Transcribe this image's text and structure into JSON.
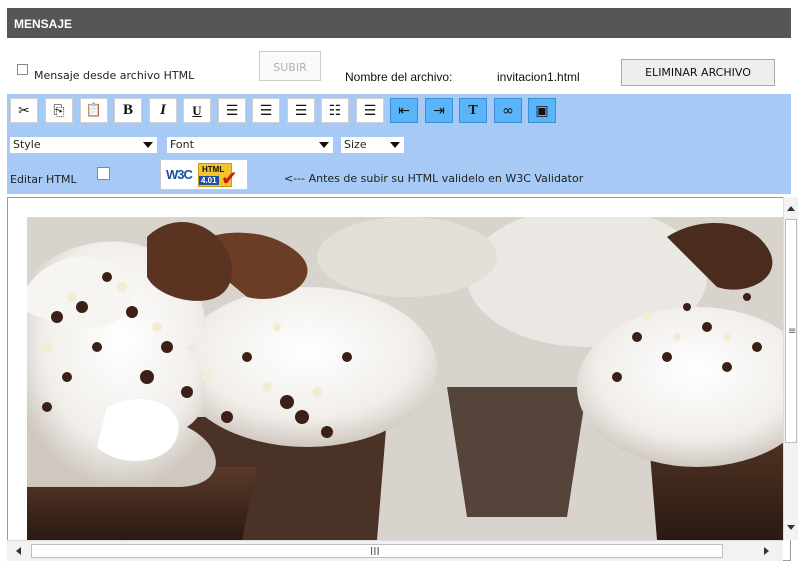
{
  "header": {
    "title": "MENSAJE"
  },
  "file_row": {
    "checkbox_label": "Mensaje desde archivo HTML",
    "upload_label": "SUBIR",
    "filename_label": "Nombre del archivo:",
    "filename_value": "invitacion1.html",
    "delete_label": "ELIMINAR ARCHIVO"
  },
  "toolbar": {
    "buttons": [
      {
        "name": "cut-icon",
        "glyph": "✂"
      },
      {
        "name": "copy-icon",
        "glyph": "⎘"
      },
      {
        "name": "paste-icon",
        "glyph": "📋"
      },
      {
        "name": "bold-icon",
        "glyph": "B"
      },
      {
        "name": "italic-icon",
        "glyph": "I"
      },
      {
        "name": "underline-icon",
        "glyph": "U"
      },
      {
        "name": "align-left-icon",
        "glyph": "≡"
      },
      {
        "name": "align-center-icon",
        "glyph": "≡"
      },
      {
        "name": "align-right-icon",
        "glyph": "≡"
      },
      {
        "name": "ordered-list-icon",
        "glyph": "☷"
      },
      {
        "name": "unordered-list-icon",
        "glyph": "☰"
      },
      {
        "name": "outdent-icon",
        "glyph": "⇤"
      },
      {
        "name": "indent-icon",
        "glyph": "⇥"
      },
      {
        "name": "text-color-icon",
        "glyph": "T"
      },
      {
        "name": "link-icon",
        "glyph": "∞"
      },
      {
        "name": "image-icon",
        "glyph": "▣"
      }
    ],
    "style_select": "Style",
    "font_select": "Font",
    "size_select": "Size",
    "edit_html_label": "Editar HTML",
    "validator_note": "<--- Antes de subir su HTML validelo en W3C Validator",
    "w3c_badge": {
      "w3c": "W3C",
      "line1": "HTML",
      "line2": "4.01"
    }
  },
  "editor": {
    "content": "cupcakes-photo"
  },
  "colors": {
    "header": "#565656",
    "toolbar_bg": "#a6c9f5",
    "highlight_button": "#5ab4f8"
  }
}
